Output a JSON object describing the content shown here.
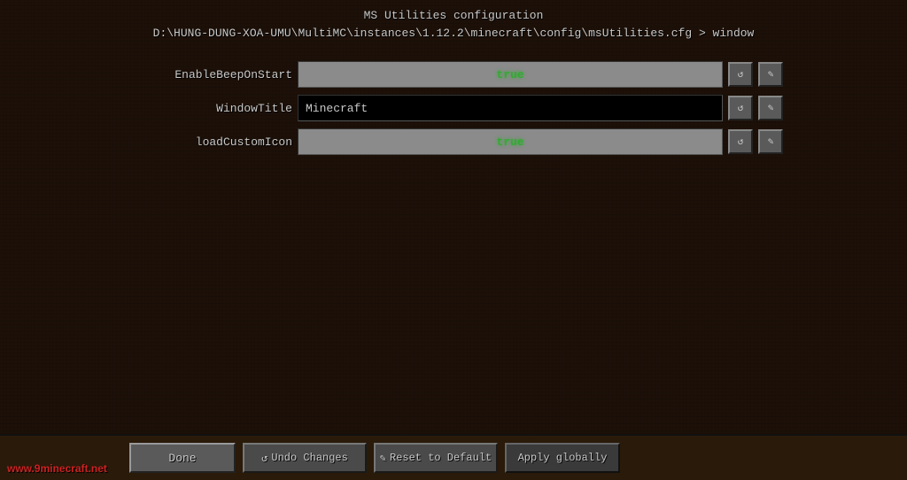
{
  "title": {
    "line1": "MS Utilities configuration",
    "line2": "D:\\HUNG-DUNG-XOA-UMU\\MultiMC\\instances\\1.12.2\\minecraft\\config\\msUtilities.cfg > window"
  },
  "config": {
    "rows": [
      {
        "label": "EnableBeepOnStart",
        "value": "true",
        "type": "boolean"
      },
      {
        "label": "WindowTitle",
        "value": "Minecraft",
        "type": "text"
      },
      {
        "label": "loadCustomIcon",
        "value": "true",
        "type": "boolean"
      }
    ],
    "reset_icon": "↺",
    "edit_icon": "✎"
  },
  "footer": {
    "done_label": "Done",
    "undo_label": "↺ Undo Changes",
    "reset_label": "✎ Reset to Default",
    "apply_label": "Apply globally",
    "watermark": "www.9minecraft.net"
  }
}
